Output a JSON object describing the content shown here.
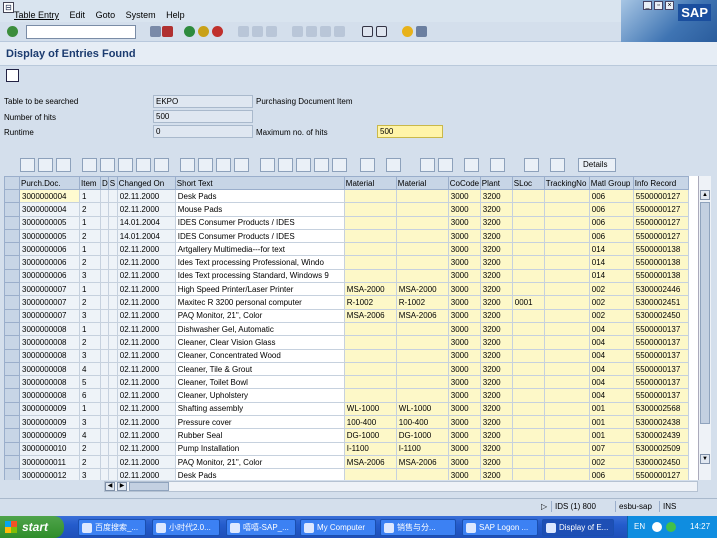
{
  "menu": [
    "Table Entry",
    "Edit",
    "Goto",
    "System",
    "Help"
  ],
  "logo": "SAP",
  "title": "Display of Entries Found",
  "fields": {
    "table_label": "Table to be searched",
    "table_value": "EKPO",
    "table_desc": "Purchasing Document Item",
    "hits_label": "Number of hits",
    "hits_value": "500",
    "runtime_label": "Runtime",
    "runtime_value": "0",
    "maxhits_label": "Maximum no. of hits",
    "maxhits_value": "500"
  },
  "details_label": "Details",
  "columns": [
    "Purch.Doc.",
    "Item",
    "D",
    "S",
    "Changed On",
    "Short Text",
    "Material",
    "Material",
    "CoCode",
    "Plant",
    "SLoc",
    "TrackingNo",
    "Matl Group",
    "Info Record"
  ],
  "rows": [
    [
      "3000000004",
      "1",
      "",
      "",
      "02.11.2000",
      "Desk Pads",
      "",
      "",
      "3000",
      "3200",
      "",
      "",
      "006",
      "5500000127"
    ],
    [
      "3000000004",
      "2",
      "",
      "",
      "02.11.2000",
      "Mouse Pads",
      "",
      "",
      "3000",
      "3200",
      "",
      "",
      "006",
      "5500000127"
    ],
    [
      "3000000005",
      "1",
      "",
      "",
      "14.01.2004",
      "IDES Consumer Products / IDES",
      "",
      "",
      "3000",
      "3200",
      "",
      "",
      "006",
      "5500000127"
    ],
    [
      "3000000005",
      "2",
      "",
      "",
      "14.01.2004",
      "IDES Consumer Products / IDES",
      "",
      "",
      "3000",
      "3200",
      "",
      "",
      "006",
      "5500000127"
    ],
    [
      "3000000006",
      "1",
      "",
      "",
      "02.11.2000",
      "Artgallery Multimedia---for text",
      "",
      "",
      "3000",
      "3200",
      "",
      "",
      "014",
      "5500000138"
    ],
    [
      "3000000006",
      "2",
      "",
      "",
      "02.11.2000",
      "Ides Text processing Professional, Windo",
      "",
      "",
      "3000",
      "3200",
      "",
      "",
      "014",
      "5500000138"
    ],
    [
      "3000000006",
      "3",
      "",
      "",
      "02.11.2000",
      "Ides Text processing Standard, Windows 9",
      "",
      "",
      "3000",
      "3200",
      "",
      "",
      "014",
      "5500000138"
    ],
    [
      "3000000007",
      "1",
      "",
      "",
      "02.11.2000",
      "High Speed Printer/Laser Printer",
      "MSA-2000",
      "MSA-2000",
      "3000",
      "3200",
      "",
      "",
      "002",
      "5300002446"
    ],
    [
      "3000000007",
      "2",
      "",
      "",
      "02.11.2000",
      "Maxitec R 3200 personal computer",
      "R-1002",
      "R-1002",
      "3000",
      "3200",
      "0001",
      "",
      "002",
      "5300002451"
    ],
    [
      "3000000007",
      "3",
      "",
      "",
      "02.11.2000",
      "PAQ Monitor, 21\", Color",
      "MSA-2006",
      "MSA-2006",
      "3000",
      "3200",
      "",
      "",
      "002",
      "5300002450"
    ],
    [
      "3000000008",
      "1",
      "",
      "",
      "02.11.2000",
      "Dishwasher Gel, Automatic",
      "",
      "",
      "3000",
      "3200",
      "",
      "",
      "004",
      "5500000137"
    ],
    [
      "3000000008",
      "2",
      "",
      "",
      "02.11.2000",
      "Cleaner, Clear Vision Glass",
      "",
      "",
      "3000",
      "3200",
      "",
      "",
      "004",
      "5500000137"
    ],
    [
      "3000000008",
      "3",
      "",
      "",
      "02.11.2000",
      "Cleaner, Concentrated Wood",
      "",
      "",
      "3000",
      "3200",
      "",
      "",
      "004",
      "5500000137"
    ],
    [
      "3000000008",
      "4",
      "",
      "",
      "02.11.2000",
      "Cleaner, Tile & Grout",
      "",
      "",
      "3000",
      "3200",
      "",
      "",
      "004",
      "5500000137"
    ],
    [
      "3000000008",
      "5",
      "",
      "",
      "02.11.2000",
      "Cleaner, Toilet Bowl",
      "",
      "",
      "3000",
      "3200",
      "",
      "",
      "004",
      "5500000137"
    ],
    [
      "3000000008",
      "6",
      "",
      "",
      "02.11.2000",
      "Cleaner, Upholstery",
      "",
      "",
      "3000",
      "3200",
      "",
      "",
      "004",
      "5500000137"
    ],
    [
      "3000000009",
      "1",
      "",
      "",
      "02.11.2000",
      "Shafting assembly",
      "WL-1000",
      "WL-1000",
      "3000",
      "3200",
      "",
      "",
      "001",
      "5300002568"
    ],
    [
      "3000000009",
      "3",
      "",
      "",
      "02.11.2000",
      "Pressure cover",
      "100-400",
      "100-400",
      "3000",
      "3200",
      "",
      "",
      "001",
      "5300002438"
    ],
    [
      "3000000009",
      "4",
      "",
      "",
      "02.11.2000",
      "Rubber Seal",
      "DG-1000",
      "DG-1000",
      "3000",
      "3200",
      "",
      "",
      "001",
      "5300002439"
    ],
    [
      "3000000010",
      "2",
      "",
      "",
      "02.11.2000",
      "Pump Installation",
      "I-1100",
      "I-1100",
      "3000",
      "3200",
      "",
      "",
      "007",
      "5300002509"
    ],
    [
      "3000000011",
      "2",
      "",
      "",
      "02.11.2000",
      "PAQ Monitor, 21\", Color",
      "MSA-2006",
      "MSA-2006",
      "3000",
      "3200",
      "",
      "",
      "002",
      "5300002450"
    ],
    [
      "3000000012",
      "3",
      "",
      "",
      "02.11.2000",
      "Desk Pads",
      "",
      "",
      "3000",
      "3200",
      "",
      "",
      "006",
      "5500000127"
    ]
  ],
  "status": {
    "system": "IDS (1) 800",
    "server": "esbu-sap",
    "mode": "INS"
  },
  "taskbar": {
    "start": "start",
    "tasks": [
      "百度搜索_...",
      "小时代2.0...",
      "嘻嘻-SAP_...",
      "My Computer",
      "销售与分...",
      "SAP Logon ...",
      "Display of E..."
    ],
    "lang": "EN",
    "time": "14:27"
  }
}
